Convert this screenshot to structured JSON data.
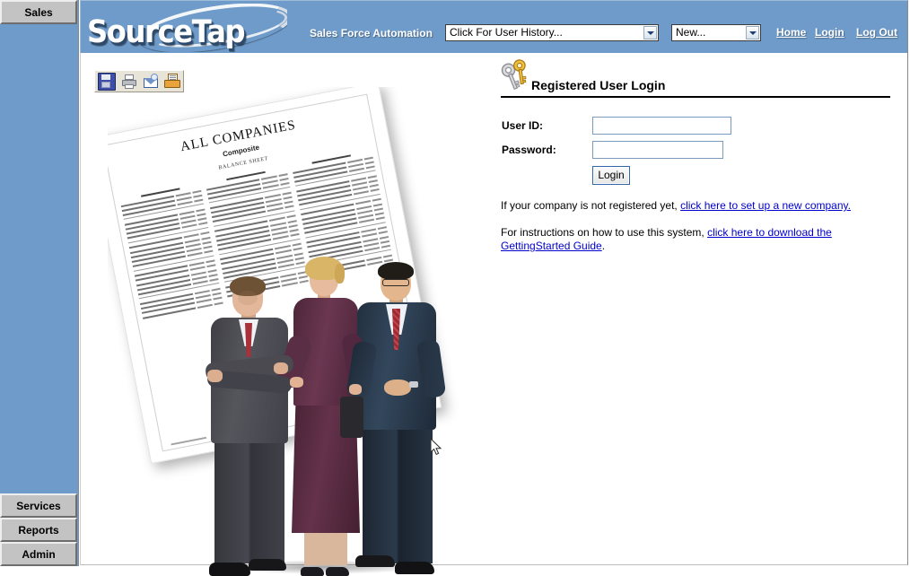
{
  "sidebar": {
    "top_items": [
      {
        "label": "Sales",
        "name": "sidebar-item-sales"
      }
    ],
    "bottom_items": [
      {
        "label": "Services",
        "name": "sidebar-item-services"
      },
      {
        "label": "Reports",
        "name": "sidebar-item-reports"
      },
      {
        "label": "Admin",
        "name": "sidebar-item-admin"
      }
    ],
    "background_color": "#6e9bc9",
    "button_color": "#c3c3c3"
  },
  "header": {
    "logo_text": "SourceTap",
    "tagline": "Sales Force Automation",
    "background_color": "#6e9bc9",
    "user_history_select": {
      "value": "Click For User History...",
      "options": [
        "Click For User History..."
      ]
    },
    "new_select": {
      "value": "New...",
      "options": [
        "New..."
      ]
    },
    "links": [
      {
        "label": "Home",
        "name": "nav-link-home"
      },
      {
        "label": "Login",
        "name": "nav-link-login"
      },
      {
        "label": "Log Out",
        "name": "nav-link-logout"
      }
    ]
  },
  "toolbar": {
    "buttons": [
      {
        "label": "Save",
        "icon": "save-icon"
      },
      {
        "label": "Print",
        "icon": "print-icon"
      },
      {
        "label": "Email",
        "icon": "email-icon"
      },
      {
        "label": "Print Preview",
        "icon": "print-preview-icon"
      }
    ]
  },
  "hero": {
    "document": {
      "title": "ALL COMPANIES",
      "subtitle": "Composite",
      "section": "BALANCE SHEET"
    },
    "alt": "Three business professionals standing in front of a tilted balance sheet report"
  },
  "login": {
    "panel_title": "Registered User Login",
    "title_icon": "keys-icon",
    "fields": [
      {
        "label": "User ID:",
        "value": "",
        "placeholder": "",
        "name": "user-id-field"
      },
      {
        "label": "Password:",
        "value": "",
        "placeholder": "",
        "name": "password-field"
      }
    ],
    "submit_label": "Login",
    "note_register_prefix": "If your company is not registered yet, ",
    "note_register_link": "click here to set up a new company.",
    "note_guide_prefix": "For instructions on how to use this system, ",
    "note_guide_link": "click here to download the GettingStarted Guide",
    "note_guide_suffix": ".",
    "link_color": "#0000cc"
  }
}
